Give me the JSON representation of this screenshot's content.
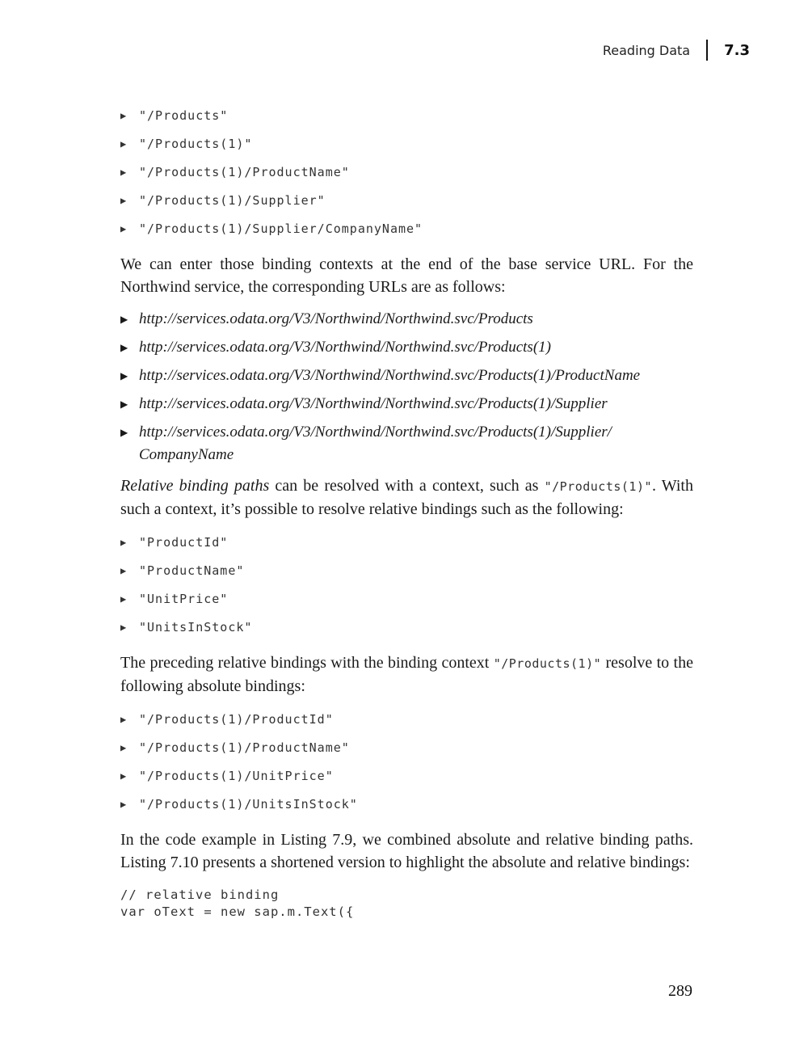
{
  "header": {
    "title": "Reading Data",
    "section": "7.3"
  },
  "list_absolute_paths": [
    "\"/Products\"",
    "\"/Products(1)\"",
    "\"/Products(1)/ProductName\"",
    "\"/Products(1)/Supplier\"",
    "\"/Products(1)/Supplier/CompanyName\""
  ],
  "para_urls_intro": "We can enter those binding contexts at the end of the base service URL. For the Northwind service, the corresponding URLs are as follows:",
  "list_urls": [
    "http://services.odata.org/V3/Northwind/Northwind.svc/Products",
    "http://services.odata.org/V3/Northwind/Northwind.svc/Products(1)",
    "http://services.odata.org/V3/Northwind/Northwind.svc/Products(1)/ProductName",
    "http://services.odata.org/V3/Northwind/Northwind.svc/Products(1)/Supplier",
    "http://services.odata.org/V3/Northwind/Northwind.svc/Products(1)/Supplier/ CompanyName"
  ],
  "para_relative": {
    "emphasis": "Relative binding paths",
    "text_a": " can be resolved with a context, such as ",
    "code": "\"/Products(1)\"",
    "text_b": ". With such a context, it’s possible to resolve relative bindings such as the following:"
  },
  "list_relative": [
    "\"ProductId\"",
    "\"ProductName\"",
    "\"UnitPrice\"",
    "\"UnitsInStock\""
  ],
  "para_preceding": {
    "text_a": "The preceding relative bindings with the binding context ",
    "code": "\"/Products(1)\"",
    "text_b": " resolve to the following absolute bindings:"
  },
  "list_resolved": [
    "\"/Products(1)/ProductId\"",
    "\"/Products(1)/ProductName\"",
    "\"/Products(1)/UnitPrice\"",
    "\"/Products(1)/UnitsInStock\""
  ],
  "para_listing": "In the code example in Listing 7.9, we combined absolute and relative binding paths. Listing 7.10 presents a shortened version to highlight the absolute and relative bindings:",
  "code_lines": [
    "// relative binding",
    "var oText = new sap.m.Text({"
  ],
  "page_number": "289"
}
